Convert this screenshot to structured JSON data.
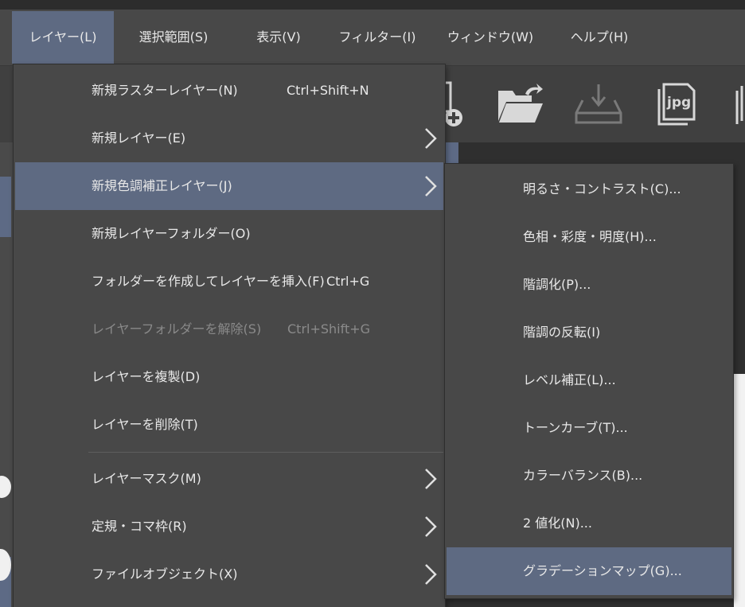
{
  "menubar": {
    "items": [
      {
        "label": "レイヤー(L)"
      },
      {
        "label": "選択範囲(S)"
      },
      {
        "label": "表示(V)"
      },
      {
        "label": "フィルター(I)"
      },
      {
        "label": "ウィンドウ(W)"
      },
      {
        "label": "ヘルプ(H)"
      }
    ]
  },
  "toolbar": {
    "icons": [
      "new-file-icon",
      "open-folder-icon",
      "download-tray-icon",
      "jpg-export-icon"
    ],
    "jpg_label": "jpg"
  },
  "layer_menu": {
    "items": [
      {
        "label": "新規ラスターレイヤー(N)",
        "shortcut": "Ctrl+Shift+N"
      },
      {
        "label": "新規レイヤー(E)"
      },
      {
        "label": "新規色調補正レイヤー(J)"
      },
      {
        "label": "新規レイヤーフォルダー(O)"
      },
      {
        "label": "フォルダーを作成してレイヤーを挿入(F)",
        "shortcut": "Ctrl+G"
      },
      {
        "label": "レイヤーフォルダーを解除(S)",
        "shortcut": "Ctrl+Shift+G"
      },
      {
        "label": "レイヤーを複製(D)"
      },
      {
        "label": "レイヤーを削除(T)"
      },
      {
        "label": "レイヤーマスク(M)"
      },
      {
        "label": "定規・コマ枠(R)"
      },
      {
        "label": "ファイルオブジェクト(X)"
      }
    ]
  },
  "adjustment_submenu": {
    "items": [
      {
        "label": "明るさ・コントラスト(C)..."
      },
      {
        "label": "色相・彩度・明度(H)..."
      },
      {
        "label": "階調化(P)..."
      },
      {
        "label": "階調の反転(I)"
      },
      {
        "label": "レベル補正(L)..."
      },
      {
        "label": "トーンカーブ(T)..."
      },
      {
        "label": "カラーバランス(B)..."
      },
      {
        "label": "2 値化(N)..."
      },
      {
        "label": "グラデーションマップ(G)..."
      }
    ]
  }
}
